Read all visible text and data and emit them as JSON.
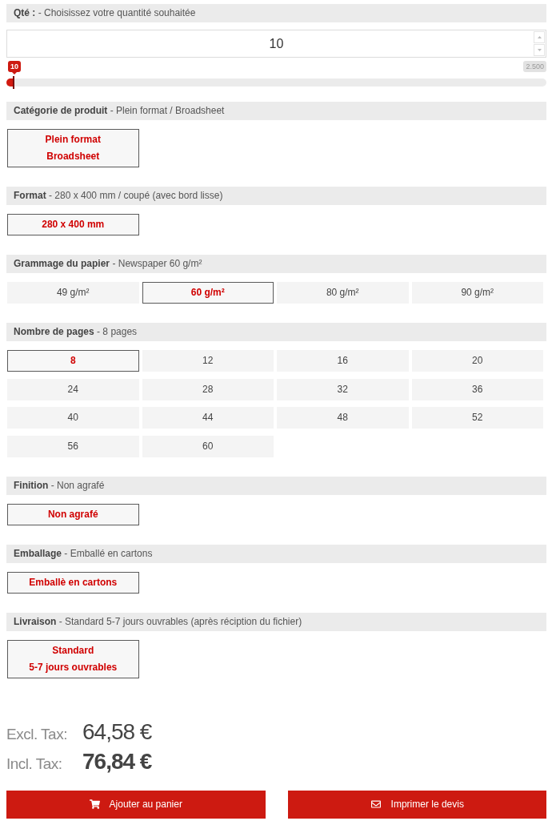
{
  "quantity": {
    "heading": "**Qté :** - Choisissez votre quantité souhaitée",
    "value": "10",
    "slider": {
      "level": 0.012,
      "value_badge": "10",
      "max_badge": "2.500"
    }
  },
  "sections": [
    {
      "heading": "**Catégorie de produit** - Plein format / Broadsheet",
      "options": [
        {
          "lines": [
            "Plein format",
            "Broadsheet"
          ],
          "selected": true
        }
      ]
    },
    {
      "heading": "**Format** - 280 x 400 mm / coupé (avec bord lisse)",
      "options": [
        {
          "lines": [
            "280 x 400 mm"
          ],
          "selected": true
        }
      ]
    },
    {
      "heading": "**Grammage du papier** - Newspaper 60 g/m²",
      "options": [
        {
          "lines": [
            "49 g/m²"
          ],
          "selected": false
        },
        {
          "lines": [
            "60 g/m²"
          ],
          "selected": true
        },
        {
          "lines": [
            "80 g/m²"
          ],
          "selected": false
        },
        {
          "lines": [
            "90 g/m²"
          ],
          "selected": false
        }
      ]
    },
    {
      "heading": "**Nombre de pages** - 8 pages",
      "options": [
        {
          "lines": [
            "8"
          ],
          "selected": true
        },
        {
          "lines": [
            "12"
          ],
          "selected": false
        },
        {
          "lines": [
            "16"
          ],
          "selected": false
        },
        {
          "lines": [
            "20"
          ],
          "selected": false
        },
        {
          "lines": [
            "24"
          ],
          "selected": false
        },
        {
          "lines": [
            "28"
          ],
          "selected": false
        },
        {
          "lines": [
            "32"
          ],
          "selected": false
        },
        {
          "lines": [
            "36"
          ],
          "selected": false
        },
        {
          "lines": [
            "40"
          ],
          "selected": false
        },
        {
          "lines": [
            "44"
          ],
          "selected": false
        },
        {
          "lines": [
            "48"
          ],
          "selected": false
        },
        {
          "lines": [
            "52"
          ],
          "selected": false
        },
        {
          "lines": [
            "56"
          ],
          "selected": false
        },
        {
          "lines": [
            "60"
          ],
          "selected": false
        }
      ]
    },
    {
      "heading": "**Finition** - Non agrafé",
      "options": [
        {
          "lines": [
            "Non agrafé"
          ],
          "selected": true
        }
      ]
    },
    {
      "heading": "**Emballage** - Emballé en cartons",
      "options": [
        {
          "lines": [
            "Emballè en cartons"
          ],
          "selected": true
        }
      ]
    },
    {
      "heading": "**Livraison** - Standard 5-7 jours ouvrables (après réciption du fichier)",
      "options": [
        {
          "lines": [
            "Standard",
            "5-7 jours ouvrables"
          ],
          "selected": true
        }
      ]
    }
  ],
  "prices": [
    {
      "label": "Excl. Tax:",
      "value": "64,58 €",
      "kind": "excl"
    },
    {
      "label": "Incl. Tax:",
      "value": "76,84 €",
      "kind": "incl"
    }
  ],
  "buttons": [
    {
      "label": "Ajouter au panier",
      "kind": "cart"
    },
    {
      "label": "Imprimer le devis",
      "kind": "quote"
    }
  ]
}
